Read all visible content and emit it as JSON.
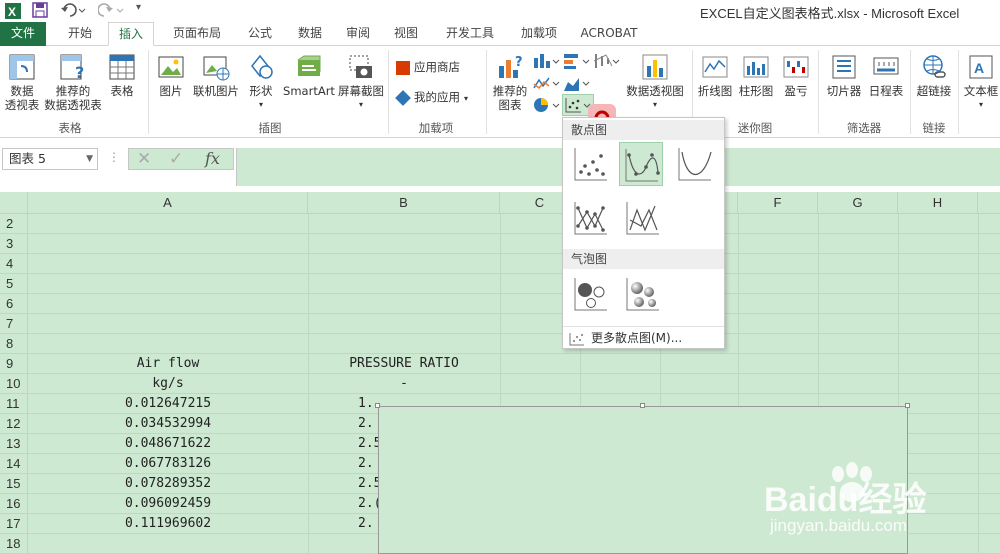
{
  "window": {
    "title": "EXCEL自定义图表格式.xlsx - Microsoft Excel"
  },
  "tabs": [
    "文件",
    "开始",
    "插入",
    "页面布局",
    "公式",
    "数据",
    "审阅",
    "视图",
    "开发工具",
    "加载项",
    "ACROBAT"
  ],
  "active_tab": "插入",
  "ribbon": {
    "groups": {
      "tables": "表格",
      "illustrations": "插图",
      "addins": "加载项",
      "sparklines": "迷你图",
      "filters": "筛选器",
      "links": "链接"
    },
    "buttons": {
      "pivot_line1": "数据",
      "pivot_line2": "透视表",
      "rec_pivot_line1": "推荐的",
      "rec_pivot_line2": "数据透视表",
      "table": "表格",
      "pictures": "图片",
      "online_pictures": "联机图片",
      "shapes": "形状",
      "smartart": "SmartArt",
      "screenshot": "屏幕截图",
      "store": "应用商店",
      "my_apps": "我的应用",
      "rec_charts_line1": "推荐的",
      "rec_charts_line2": "图表",
      "pivot_chart": "数据透视图",
      "line_spark": "折线图",
      "column_spark": "柱形图",
      "winloss_spark": "盈亏",
      "slicer": "切片器",
      "timeline": "日程表",
      "hyperlink": "超链接",
      "textbox": "文本框"
    }
  },
  "namebox": "图表 5",
  "formula": "",
  "columns": [
    "A",
    "B",
    "C",
    "F",
    "G",
    "H"
  ],
  "rows": [
    {
      "n": "2",
      "a": "",
      "b": ""
    },
    {
      "n": "3",
      "a": "",
      "b": ""
    },
    {
      "n": "4",
      "a": "",
      "b": ""
    },
    {
      "n": "5",
      "a": "",
      "b": ""
    },
    {
      "n": "6",
      "a": "",
      "b": ""
    },
    {
      "n": "7",
      "a": "",
      "b": ""
    },
    {
      "n": "8",
      "a": "",
      "b": ""
    },
    {
      "n": "9",
      "a": "Air flow",
      "b": "PRESSURE RATIO"
    },
    {
      "n": "10",
      "a": "kg/s",
      "b": "-"
    },
    {
      "n": "11",
      "a": "0.012647215",
      "b": "1."
    },
    {
      "n": "12",
      "a": "0.034532994",
      "b": "2."
    },
    {
      "n": "13",
      "a": "0.048671622",
      "b": "2.5"
    },
    {
      "n": "14",
      "a": "0.067783126",
      "b": "2."
    },
    {
      "n": "15",
      "a": "0.078289352",
      "b": "2.5"
    },
    {
      "n": "16",
      "a": "0.096092459",
      "b": "2.("
    },
    {
      "n": "17",
      "a": "0.111969602",
      "b": "2."
    },
    {
      "n": "18",
      "a": "",
      "b": ""
    }
  ],
  "dropdown": {
    "scatter_header": "散点图",
    "bubble_header": "气泡图",
    "more_scatter": "更多散点图(M)..."
  },
  "watermark": {
    "brand": "Baidu经验",
    "url": "jingyan.baidu.com"
  },
  "colors": {
    "excel_green": "#217346",
    "grid_green": "#cde9d2"
  }
}
